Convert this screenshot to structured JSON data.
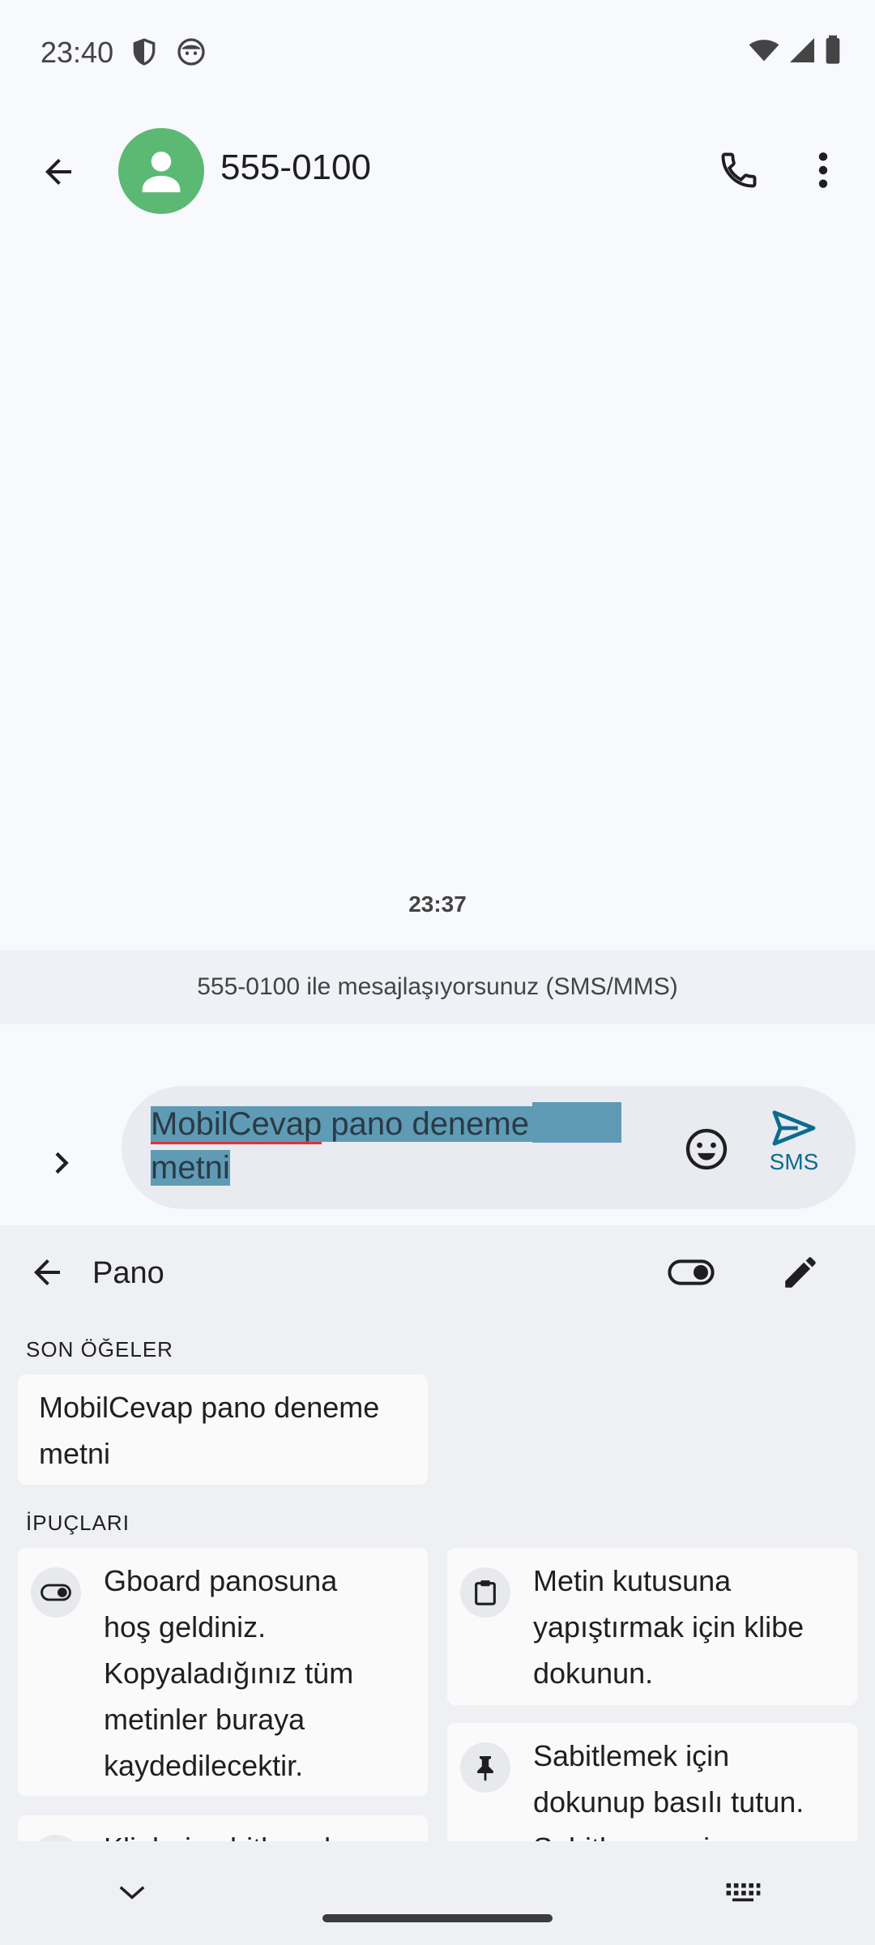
{
  "status_bar": {
    "time": "23:40"
  },
  "header": {
    "contact": "555-0100"
  },
  "conversation": {
    "timestamp": "23:37",
    "info_banner": "555-0100 ile mesajlaşıyorsunuz (SMS/MMS)"
  },
  "compose": {
    "text_line1": "MobilCevap pano deneme",
    "text_line2": "metni",
    "send_label": "SMS"
  },
  "clipboard": {
    "title": "Pano",
    "recent_label": "SON ÖĞELER",
    "recent_item_line1": "MobilCevap pano deneme",
    "recent_item_line2": "metni",
    "tips_label": "İPUÇLARI",
    "tip1": [
      "Gboard panosuna",
      "hoş geldiniz.",
      "Kopyaladığınız tüm",
      "metinler buraya",
      "kaydedilecektir."
    ],
    "tip2": [
      "Metin kutusuna",
      "yapıştırmak için klibe",
      "dokunun."
    ],
    "tip3": [
      "Sabitlemek için",
      "dokunup basılı tutun.",
      "Sabitlenmemiş"
    ],
    "tip4": [
      "Klipleri sabitlemek"
    ]
  },
  "colors": {
    "avatar": "#5bb974",
    "selection": "#5f9bb5",
    "accent": "#0b6c8e"
  }
}
